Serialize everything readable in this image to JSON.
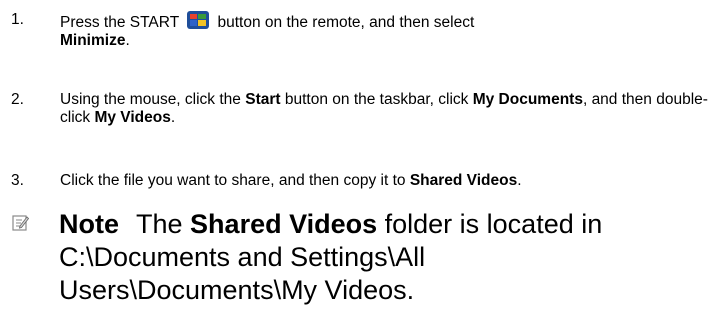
{
  "steps": [
    {
      "number": "1.",
      "before_icon": "Press the START ",
      "icon": "windows-start-icon",
      "after_icon": " button on the remote, and then select ",
      "bold_1": "Minimize",
      "tail": "."
    },
    {
      "number": "2.",
      "part_1": "Using the mouse, click the ",
      "bold_1": "Start",
      "part_2": " button on the taskbar, click ",
      "bold_2": "My Documents",
      "part_3": ", and then double-click ",
      "bold_3": "My Videos",
      "tail": "."
    },
    {
      "number": "3.",
      "part_1": "Click the file you want to share, and then copy it to ",
      "bold_1": "Shared Videos",
      "tail": "."
    }
  ],
  "note": {
    "icon": "note-pencil-icon",
    "label": "Note",
    "part_1": " The ",
    "bold_1": "Shared Videos",
    "part_2": " folder is located in C:\\Documents and Settings\\All Users\\Documents\\My Videos."
  },
  "colors": {
    "text": "#000000",
    "background": "#ffffff",
    "icon_green": "#3a9a3a",
    "icon_red": "#e8412c",
    "icon_blue": "#2f62c8",
    "icon_yellow": "#f3c325",
    "note_icon": "#8a8a8a"
  }
}
